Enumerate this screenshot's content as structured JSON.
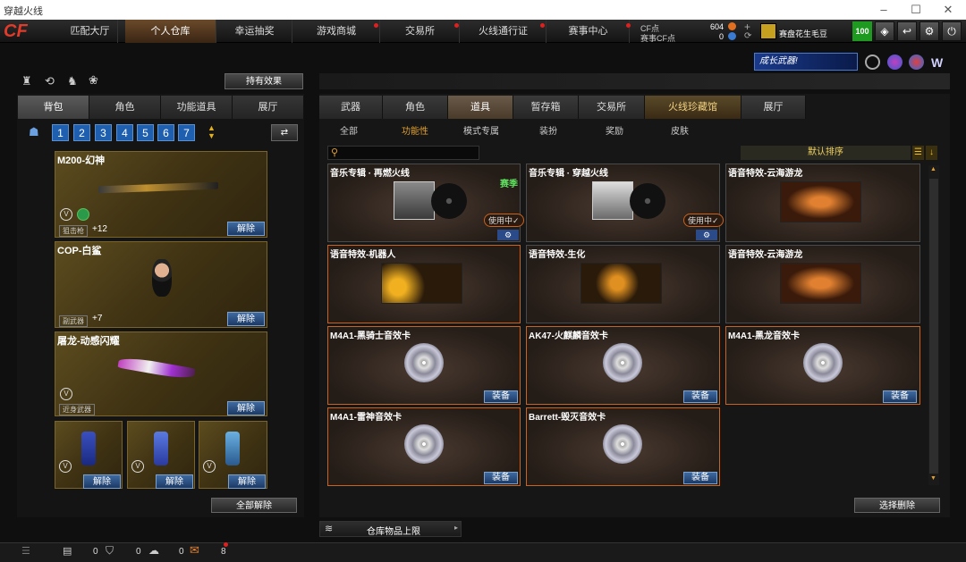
{
  "window": {
    "title": "穿越火线",
    "min": "–",
    "max": "☐",
    "close": "✕"
  },
  "nav": [
    "匹配大厅",
    "个人仓库",
    "幸运抽奖",
    "游戏商城",
    "交易所",
    "火线通行证",
    "赛事中心"
  ],
  "currency": {
    "cf_label": "CF点",
    "cf_value": "604",
    "ecf_label": "赛事CF点",
    "ecf_value": "0",
    "user": "赛盘花生毛豆",
    "level": "100"
  },
  "banner": {
    "text": "成长武器!"
  },
  "left": {
    "effect_btn": "持有效果",
    "tabs": [
      "背包",
      "角色",
      "功能道具",
      "展厅"
    ],
    "pages": [
      "1",
      "2",
      "3",
      "4",
      "5",
      "6",
      "7"
    ],
    "items": [
      {
        "name": "M200-幻神",
        "tag": "狙击枪",
        "plus": "+12",
        "btn": "解除"
      },
      {
        "name": "COP-白鲨",
        "tag": "副武器",
        "plus": "+7",
        "btn": "解除"
      },
      {
        "name": "屠龙-动感闪耀",
        "tag": "近身武器",
        "btn": "解除"
      }
    ],
    "grenades": [
      {
        "btn": "解除"
      },
      {
        "btn": "解除"
      },
      {
        "btn": "解除"
      }
    ],
    "all_release": "全部解除"
  },
  "right": {
    "tabs": [
      "武器",
      "角色",
      "道具",
      "暂存箱",
      "交易所",
      "火线珍藏馆",
      "展厅"
    ],
    "subs": [
      "全部",
      "功能性",
      "模式专属",
      "装扮",
      "奖励",
      "皮肤"
    ],
    "search_placeholder": "",
    "sort": "默认排序",
    "items": [
      {
        "name": "音乐专辑 · 再燃火线",
        "badge": "赛季",
        "status": "使用中✓"
      },
      {
        "name": "音乐专辑 · 穿越火线",
        "status": "使用中✓"
      },
      {
        "name": "语音特效-云海游龙"
      },
      {
        "name": "语音特效-机器人"
      },
      {
        "name": "语音特效-生化"
      },
      {
        "name": "语音特效-云海游龙"
      },
      {
        "name": "M4A1-黑骑士音效卡",
        "btn": "装备"
      },
      {
        "name": "AK47-火麒麟音效卡",
        "btn": "装备"
      },
      {
        "name": "M4A1-黑龙音效卡",
        "btn": "装备"
      },
      {
        "name": "M4A1-雷神音效卡",
        "btn": "装备"
      },
      {
        "name": "Barrett-毁灭音效卡",
        "btn": "装备"
      }
    ],
    "select_delete": "选择删除",
    "warehouse_limit": "仓库物品上限"
  },
  "status": {
    "a": "0",
    "b": "0",
    "c": "0",
    "d": "8"
  }
}
